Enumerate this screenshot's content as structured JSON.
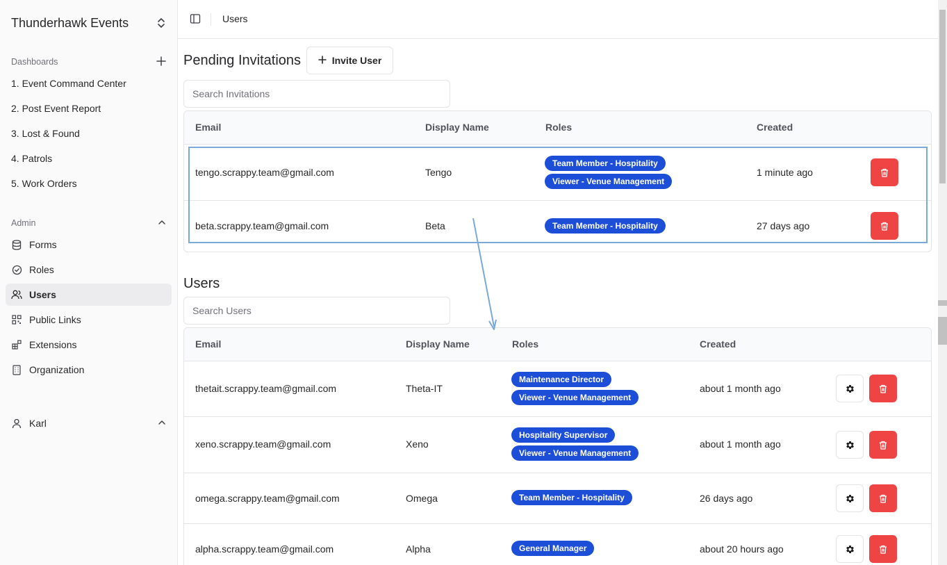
{
  "sidebar": {
    "org_name": "Thunderhawk Events",
    "dashboards_label": "Dashboards",
    "dashboards": [
      "1. Event Command Center",
      "2. Post Event Report",
      "3. Lost & Found",
      "4. Patrols",
      "5. Work Orders"
    ],
    "admin_label": "Admin",
    "admin_items": [
      {
        "label": "Forms",
        "icon": "database-icon"
      },
      {
        "label": "Roles",
        "icon": "check-circle-icon"
      },
      {
        "label": "Users",
        "icon": "users-icon",
        "active": true
      },
      {
        "label": "Public Links",
        "icon": "qr-code-icon"
      },
      {
        "label": "Extensions",
        "icon": "blocks-icon"
      },
      {
        "label": "Organization",
        "icon": "building-icon"
      }
    ],
    "user_name": "Karl"
  },
  "topbar": {
    "breadcrumb": "Users"
  },
  "pending": {
    "title": "Pending Invitations",
    "invite_label": "Invite User",
    "search_placeholder": "Search Invitations",
    "headers": [
      "Email",
      "Display Name",
      "Roles",
      "Created"
    ],
    "rows": [
      {
        "email": "tengo.scrappy.team@gmail.com",
        "name": "Tengo",
        "roles": [
          "Team Member - Hospitality",
          "Viewer - Venue Management"
        ],
        "created": "1 minute ago"
      },
      {
        "email": "beta.scrappy.team@gmail.com",
        "name": "Beta",
        "roles": [
          "Team Member - Hospitality"
        ],
        "created": "27 days ago"
      }
    ]
  },
  "users": {
    "title": "Users",
    "search_placeholder": "Search Users",
    "headers": [
      "Email",
      "Display Name",
      "Roles",
      "Created"
    ],
    "rows": [
      {
        "email": "thetait.scrappy.team@gmail.com",
        "name": "Theta-IT",
        "roles": [
          "Maintenance Director",
          "Viewer - Venue Management"
        ],
        "created": "about 1 month ago"
      },
      {
        "email": "xeno.scrappy.team@gmail.com",
        "name": "Xeno",
        "roles": [
          "Hospitality Supervisor",
          "Viewer - Venue Management"
        ],
        "created": "about 1 month ago"
      },
      {
        "email": "omega.scrappy.team@gmail.com",
        "name": "Omega",
        "roles": [
          "Team Member - Hospitality"
        ],
        "created": "26 days ago"
      },
      {
        "email": "alpha.scrappy.team@gmail.com",
        "name": "Alpha",
        "roles": [
          "General Manager"
        ],
        "created": "about 20 hours ago"
      }
    ]
  },
  "colors": {
    "badge": "#1d4ed8",
    "delete": "#ef4444",
    "highlight": "#7aa9d8"
  }
}
